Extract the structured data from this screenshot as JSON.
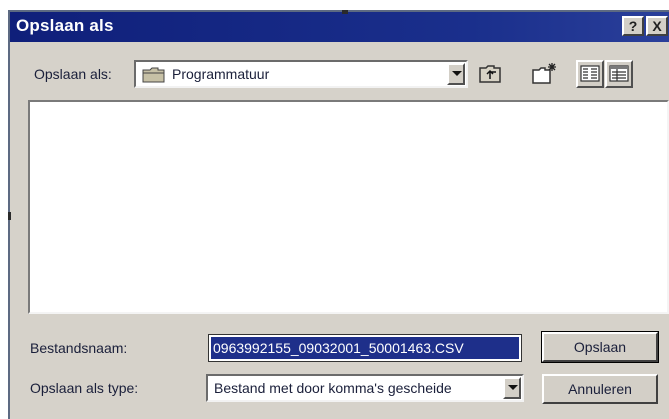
{
  "window": {
    "title": "Opslaan als",
    "help_label": "?",
    "close_label": "X"
  },
  "save_in": {
    "label": "Opslaan als:",
    "value": "Programmatuur",
    "icon": "folder-icon"
  },
  "toolbar": {
    "up_icon": "up-folder-icon",
    "new_folder_icon": "new-folder-icon",
    "list_view_icon": "list-view-icon",
    "details_view_icon": "details-view-icon"
  },
  "filename": {
    "label": "Bestandsnaam:",
    "value": "0963992155_09032001_50001463.CSV"
  },
  "filetype": {
    "label": "Opslaan als type:",
    "value": "Bestand met door komma's gescheide"
  },
  "buttons": {
    "save": "Opslaan",
    "cancel": "Annuleren"
  }
}
